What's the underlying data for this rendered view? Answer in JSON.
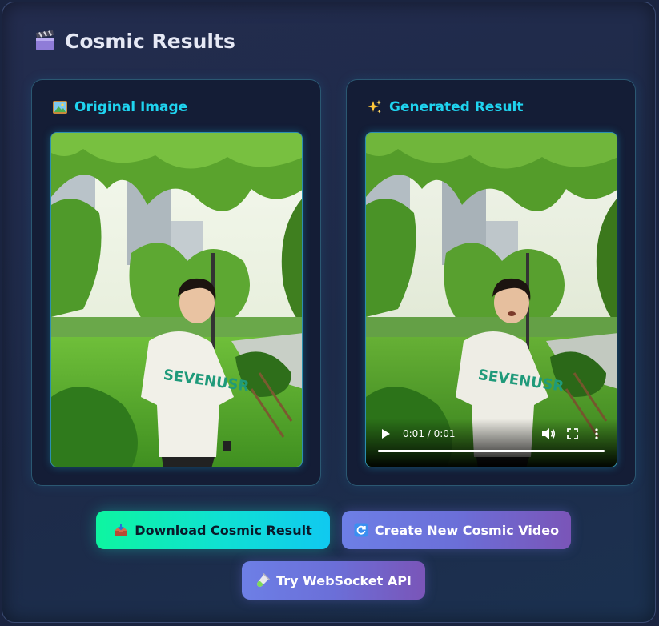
{
  "header": {
    "title": "Cosmic Results",
    "icon": "clapperboard-icon"
  },
  "original_card": {
    "title": "Original Image",
    "icon": "framed-picture-icon",
    "image": "photo-young-man-white-polo-in-park"
  },
  "generated_card": {
    "title": "Generated Result",
    "icon": "sparkles-icon",
    "video": {
      "time": "0:01 / 0:01",
      "progress": 1.0
    }
  },
  "actions": {
    "download_label": "Download Cosmic Result",
    "download_icon": "inbox-tray-icon",
    "create_label": "Create New Cosmic Video",
    "create_icon": "refresh-icon",
    "websocket_label": "Try WebSocket API",
    "websocket_icon": "test-tube-icon"
  },
  "colors": {
    "accent_cyan": "#1fd4f0",
    "download_gradient_start": "#0ef5a0",
    "download_gradient_end": "#10c9f0",
    "purple_gradient_start": "#6d7fe6",
    "purple_gradient_end": "#7a55b8"
  }
}
